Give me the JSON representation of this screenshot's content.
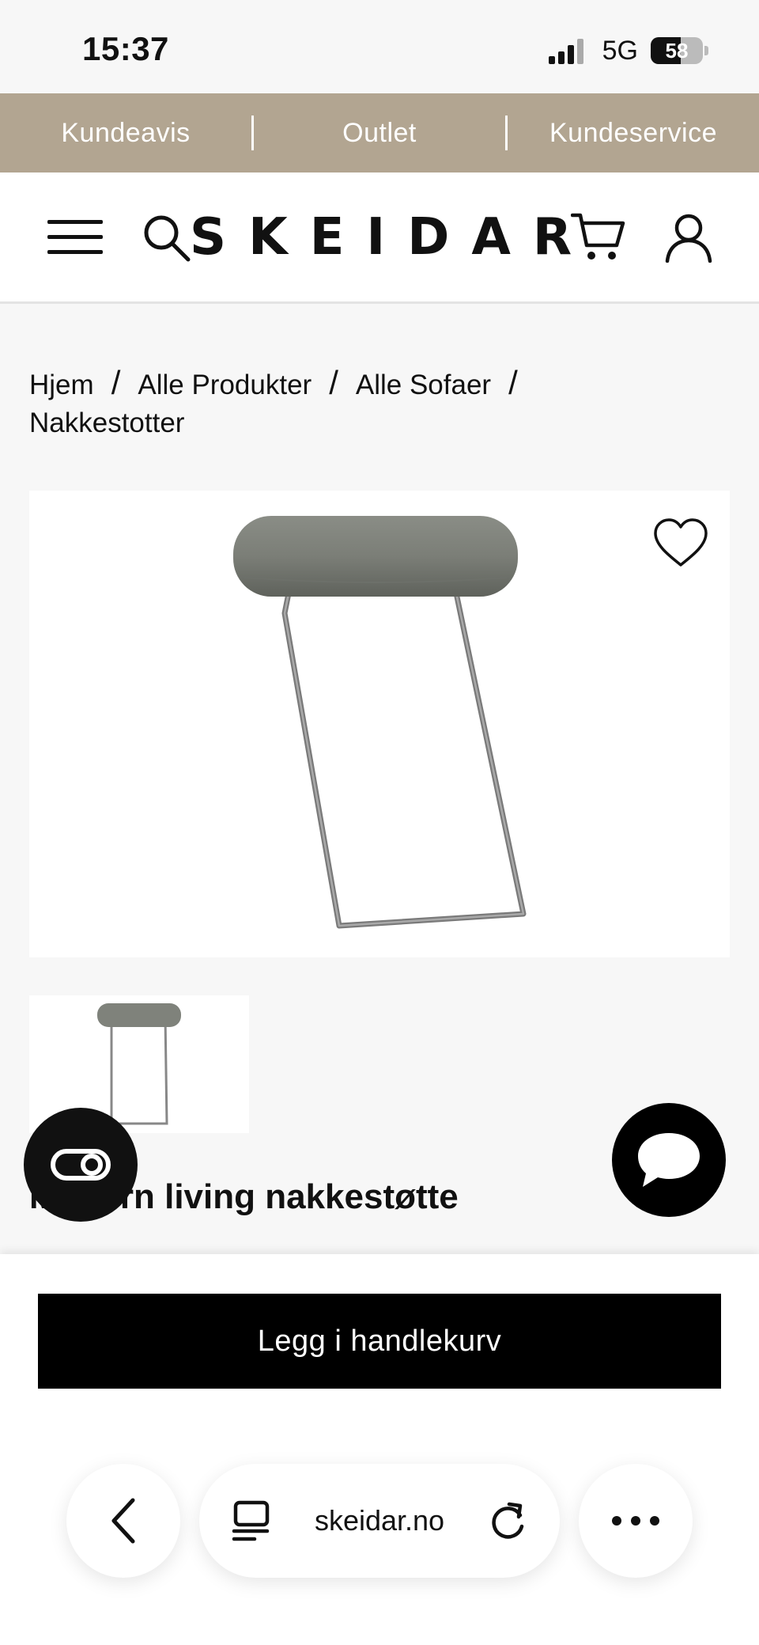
{
  "status_bar": {
    "time": "15:37",
    "network": "5G",
    "battery": "58",
    "battery_level": 0.58
  },
  "top_strip": {
    "items": [
      "Kundeavis",
      "Outlet",
      "Kundeservice"
    ]
  },
  "header": {
    "logo": "SKEIDAR",
    "icons": [
      "menu-icon",
      "search-icon",
      "cart-icon",
      "user-icon"
    ]
  },
  "breadcrumb": {
    "items": [
      "Hjem",
      "Alle Produkter",
      "Alle Sofaer",
      "Nakkestotter"
    ],
    "separator": "/"
  },
  "product": {
    "title": "Modern living nakkestøtte",
    "favorite_icon": "heart-icon"
  },
  "cta": {
    "add_to_cart": "Legg i handlekurv"
  },
  "browser": {
    "url": "skeidar.no",
    "icons": [
      "back-icon",
      "tabs-icon",
      "reload-icon",
      "more-icon"
    ]
  },
  "colors": {
    "strip_bg": "#b2a591",
    "button_bg": "#000000"
  }
}
